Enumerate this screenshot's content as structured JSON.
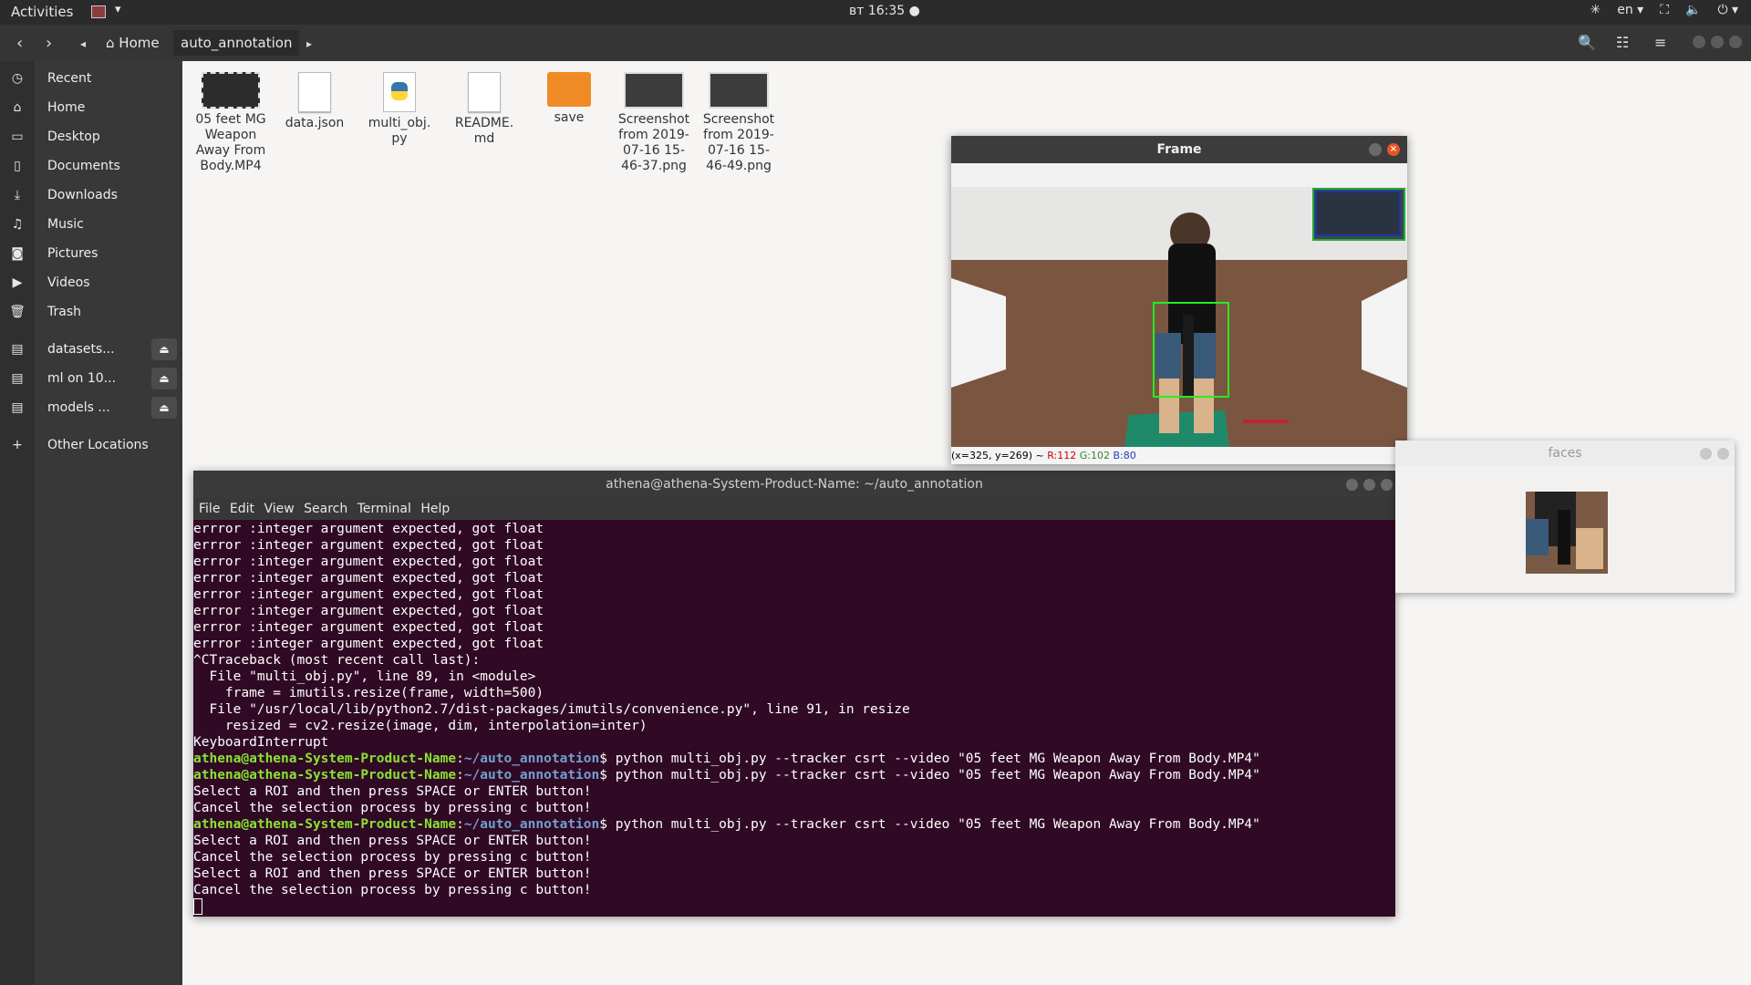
{
  "topbar": {
    "activities": "Activities",
    "clock": "вт 16:35 ●",
    "language": "en ▾",
    "icons": [
      "accessibility-icon",
      "network-icon",
      "volume-icon",
      "power-icon"
    ]
  },
  "files_header": {
    "home_label": "Home",
    "current_folder": "auto_annotation"
  },
  "sidebar": {
    "items": [
      {
        "label": "Recent",
        "icon": "clock-icon"
      },
      {
        "label": "Home",
        "icon": "home-icon"
      },
      {
        "label": "Desktop",
        "icon": "folder-icon"
      },
      {
        "label": "Documents",
        "icon": "document-icon"
      },
      {
        "label": "Downloads",
        "icon": "download-icon"
      },
      {
        "label": "Music",
        "icon": "music-icon"
      },
      {
        "label": "Pictures",
        "icon": "camera-icon"
      },
      {
        "label": "Videos",
        "icon": "video-icon"
      },
      {
        "label": "Trash",
        "icon": "trash-icon"
      }
    ],
    "mounts": [
      {
        "label": "datasets..."
      },
      {
        "label": "ml on 10..."
      },
      {
        "label": "models ..."
      }
    ],
    "other": "Other Locations"
  },
  "files": [
    {
      "name": "05 feet MG Weapon Away From Body.MP4",
      "type": "video"
    },
    {
      "name": "data.json",
      "type": "doc"
    },
    {
      "name": "multi_obj. py",
      "type": "py"
    },
    {
      "name": "README. md",
      "type": "doc"
    },
    {
      "name": "save",
      "type": "folder"
    },
    {
      "name": "Screenshot from 2019-07-16 15-46-37.png",
      "type": "shot"
    },
    {
      "name": "Screenshot from 2019-07-16 15-46-49.png",
      "type": "shot"
    }
  ],
  "terminal": {
    "title": "athena@athena-System-Product-Name: ~/auto_annotation",
    "menu": [
      "File",
      "Edit",
      "View",
      "Search",
      "Terminal",
      "Help"
    ],
    "lines": [
      {
        "text": "errror :integer argument expected, got float"
      },
      {
        "text": "errror :integer argument expected, got float"
      },
      {
        "text": "errror :integer argument expected, got float"
      },
      {
        "text": "errror :integer argument expected, got float"
      },
      {
        "text": "errror :integer argument expected, got float"
      },
      {
        "text": "errror :integer argument expected, got float"
      },
      {
        "text": "errror :integer argument expected, got float"
      },
      {
        "text": "errror :integer argument expected, got float"
      },
      {
        "text": "^CTraceback (most recent call last):"
      },
      {
        "text": "  File \"multi_obj.py\", line 89, in <module>"
      },
      {
        "text": "    frame = imutils.resize(frame, width=500)"
      },
      {
        "text": "  File \"/usr/local/lib/python2.7/dist-packages/imutils/convenience.py\", line 91, in resize"
      },
      {
        "text": "    resized = cv2.resize(image, dim, interpolation=inter)"
      },
      {
        "text": "KeyboardInterrupt"
      },
      {
        "user": "athena@athena-System-Product-Name",
        "path": "~/auto_annotation",
        "cmd": "$ python multi_obj.py --tracker csrt --video \"05 feet MG Weapon Away From Body.MP4\""
      },
      {
        "user": "athena@athena-System-Product-Name",
        "path": "~/auto_annotation",
        "cmd": "$ python multi_obj.py --tracker csrt --video \"05 feet MG Weapon Away From Body.MP4\""
      },
      {
        "text": "Select a ROI and then press SPACE or ENTER button!"
      },
      {
        "text": "Cancel the selection process by pressing c button!"
      },
      {
        "user": "athena@athena-System-Product-Name",
        "path": "~/auto_annotation",
        "cmd": "$ python multi_obj.py --tracker csrt --video \"05 feet MG Weapon Away From Body.MP4\""
      },
      {
        "text": "Select a ROI and then press SPACE or ENTER button!"
      },
      {
        "text": "Cancel the selection process by pressing c button!"
      },
      {
        "text": "Select a ROI and then press SPACE or ENTER button!"
      },
      {
        "text": "Cancel the selection process by pressing c button!"
      }
    ]
  },
  "frame_window": {
    "title": "Frame",
    "status_prefix": "(x=325, y=269) ~ ",
    "r": "R:112",
    "g": "G:102",
    "b": "B:80"
  },
  "faces_window": {
    "title": "faces"
  }
}
